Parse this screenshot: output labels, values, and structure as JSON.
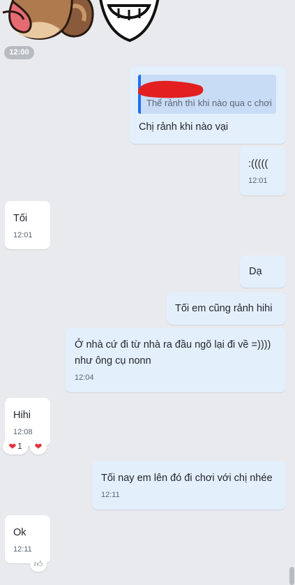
{
  "divider_time": "12:00",
  "messages": [
    {
      "reply_quote": "Thể rảnh thì khi nào qua c chơi",
      "text": "Chị rảnh khi nào vại"
    },
    {
      "text": ":(((((",
      "time": "12:01"
    },
    {
      "text": "Tối",
      "time": "12:01"
    },
    {
      "text": "Dạ"
    },
    {
      "text": "Tối em cũng rảnh hihi"
    },
    {
      "text_line1": "Ở nhà cứ đi từ nhà ra đầu ngõ lại đi về =))))",
      "text_line2": "như ông cụ nonn",
      "time": "12:04"
    },
    {
      "text": "Hihi",
      "time": "12:08",
      "reaction_count": "1"
    },
    {
      "text": "Tối nay em lên đó đi chơi với chị nhée",
      "time": "12:11"
    },
    {
      "text": "Ok",
      "time": "12:11"
    }
  ],
  "icons": {
    "heart": "heart-icon",
    "like": "thumbs-up-icon"
  },
  "colors": {
    "background": "#e9eaee",
    "incoming_bubble": "#ffffff",
    "outgoing_bubble": "#e4effc",
    "quote_bar": "#1e6ff2",
    "heart": "#e0303c"
  }
}
